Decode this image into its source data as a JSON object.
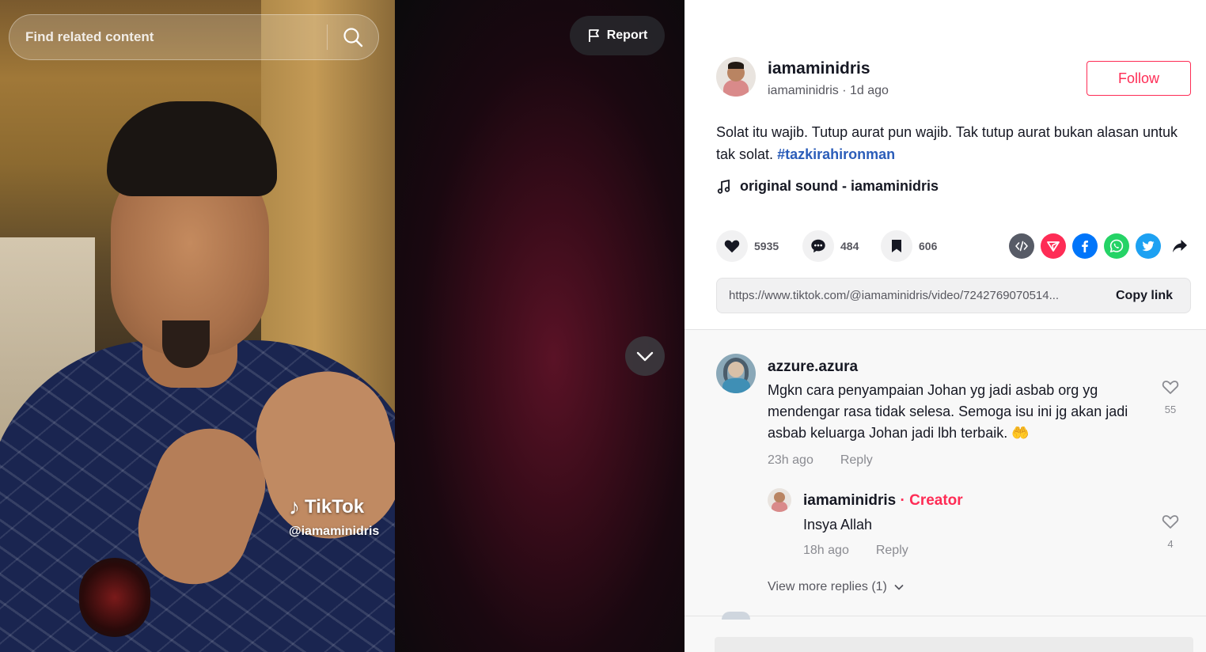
{
  "search": {
    "placeholder": "Find related content"
  },
  "video": {
    "report_label": "Report",
    "watermark_brand": "TikTok",
    "watermark_handle": "@iamaminidris"
  },
  "author": {
    "name": "iamaminidris",
    "handle": "iamaminidris",
    "time_ago": "1d ago",
    "follow_label": "Follow"
  },
  "caption": {
    "text": "Solat itu wajib. Tutup aurat pun wajib. Tak tutup aurat bukan alasan untuk tak solat.",
    "hashtag": "#tazkirahironman"
  },
  "music": {
    "label": "original sound - iamaminidris"
  },
  "actions": {
    "likes": "5935",
    "comments": "484",
    "saves": "606"
  },
  "share": {
    "icons": [
      "embed-icon",
      "send-to-friends-icon",
      "facebook-icon",
      "whatsapp-icon",
      "twitter-icon",
      "share-arrow-icon"
    ]
  },
  "link": {
    "url": "https://www.tiktok.com/@iamaminidris/video/7242769070514...",
    "copy_label": "Copy link"
  },
  "comments": [
    {
      "username": "azzure.azura",
      "text": "Mgkn cara penyampaian Johan yg jadi asbab org yg mendengar rasa tidak selesa. Semoga isu ini jg akan jadi asbab keluarga Johan jadi lbh terbaik. 🤲",
      "time_ago": "23h ago",
      "reply_label": "Reply",
      "likes": "55"
    }
  ],
  "reply": {
    "username": "iamaminidris",
    "tag": "Creator",
    "separator": " · ",
    "text": "Insya Allah",
    "time_ago": "18h ago",
    "reply_label": "Reply",
    "likes": "4"
  },
  "view_more_label": "View more replies (1)",
  "colors": {
    "brand_red": "#fe2c55",
    "hashtag_blue": "#2b5db9",
    "facebook": "#0075fa",
    "whatsapp": "#25d366",
    "twitter": "#1da1f2"
  }
}
